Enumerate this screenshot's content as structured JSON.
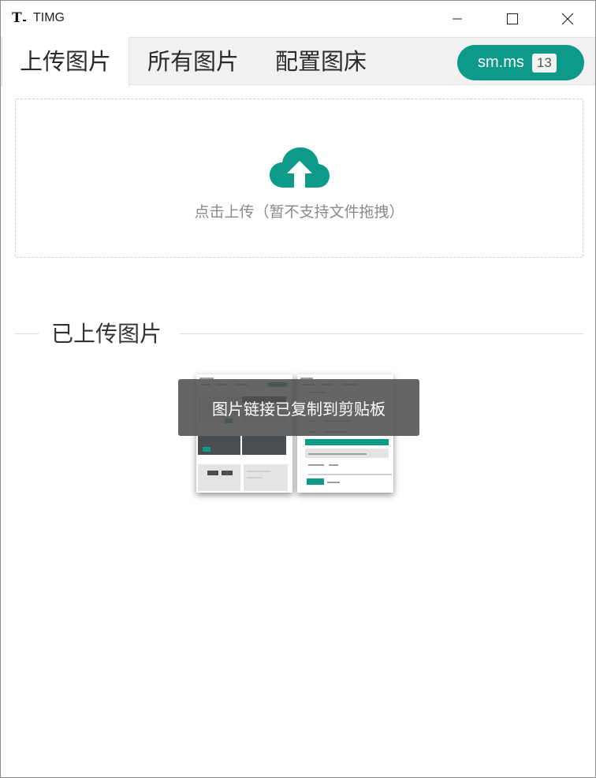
{
  "window": {
    "title": "TIMG",
    "logo_letter": "T"
  },
  "tabs": [
    {
      "label": "上传图片",
      "active": true
    },
    {
      "label": "所有图片",
      "active": false
    },
    {
      "label": "配置图床",
      "active": false
    }
  ],
  "host": {
    "name": "sm.ms",
    "count": "13"
  },
  "upload": {
    "hint": "点击上传（暂不支持文件拖拽）",
    "icon": "cloud-upload-icon"
  },
  "uploaded_section": {
    "title": "已上传图片"
  },
  "toast": {
    "message": "图片链接已复制到剪贴板"
  },
  "colors": {
    "accent": "#0d9a88"
  }
}
